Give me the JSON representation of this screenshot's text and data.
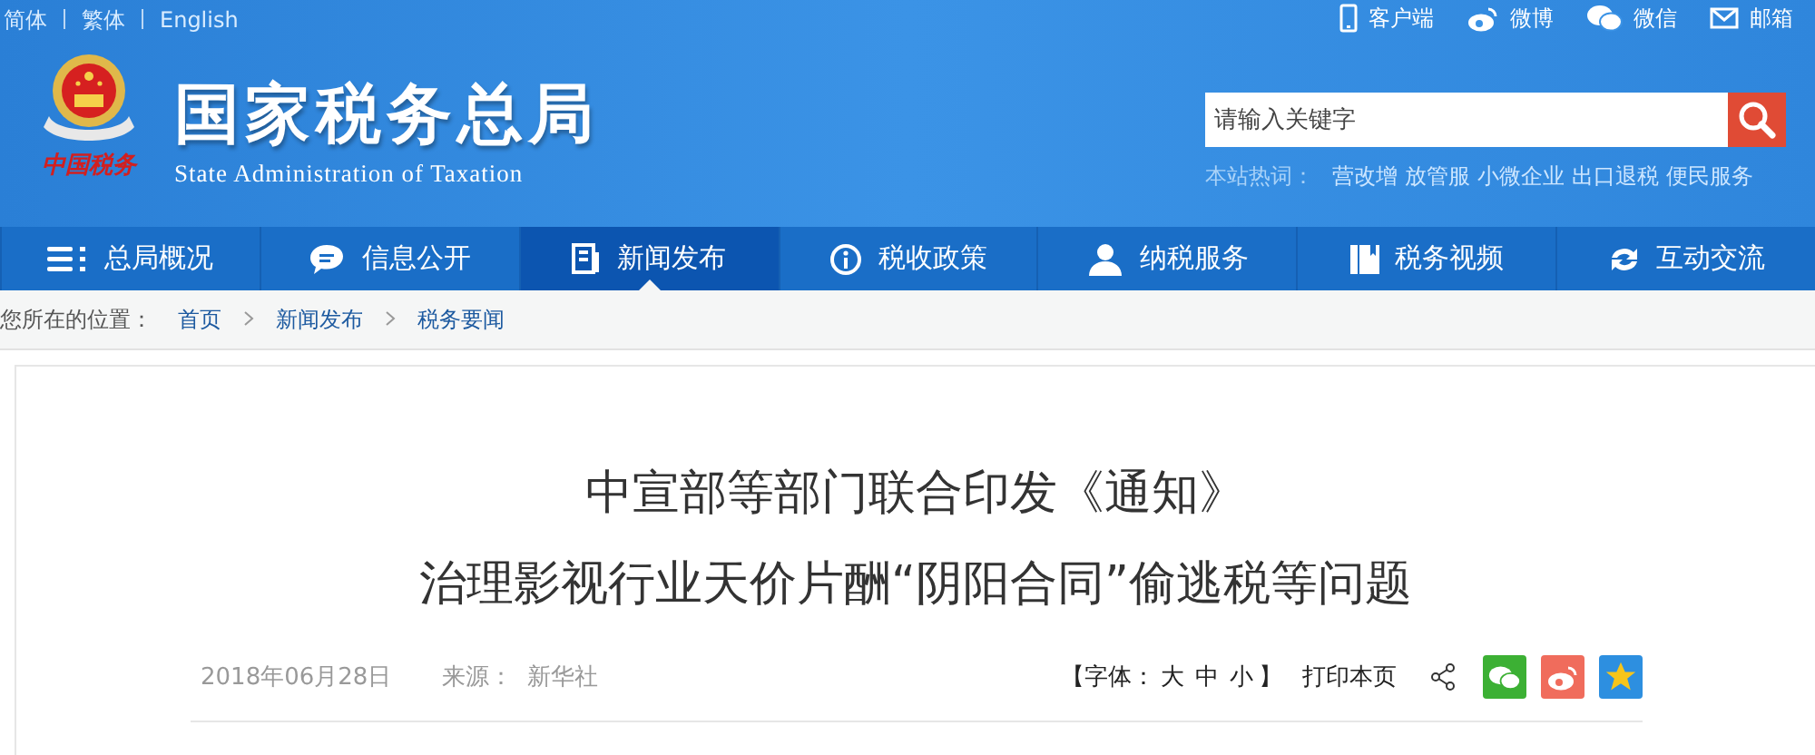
{
  "top_bar": {
    "languages": [
      "简体",
      "繁体",
      "English"
    ],
    "links": [
      {
        "label": "客户端"
      },
      {
        "label": "微博"
      },
      {
        "label": "微信"
      },
      {
        "label": "邮箱"
      }
    ]
  },
  "brand": {
    "seal_text": "中国税务",
    "title": "国家税务总局",
    "subtitle": "State Administration of Taxation"
  },
  "search": {
    "placeholder": "请输入关键字",
    "hot_label": "本站热词：",
    "hot_words": [
      "营改增",
      "放管服",
      "小微企业",
      "出口退税",
      "便民服务"
    ]
  },
  "nav": [
    {
      "label": "总局概况",
      "selected": false
    },
    {
      "label": "信息公开",
      "selected": false
    },
    {
      "label": "新闻发布",
      "selected": true
    },
    {
      "label": "税收政策",
      "selected": false
    },
    {
      "label": "纳税服务",
      "selected": false
    },
    {
      "label": "税务视频",
      "selected": false
    },
    {
      "label": "互动交流",
      "selected": false
    }
  ],
  "breadcrumb": {
    "label": "您所在的位置：",
    "items": [
      "首页",
      "新闻发布",
      "税务要闻"
    ]
  },
  "article": {
    "title_lines": [
      "中宣部等部门联合印发《通知》",
      "治理影视行业天价片酬“阴阳合同”偷逃税等问题"
    ],
    "date": "2018年06月28日",
    "source_label": "来源：",
    "source": "新华社",
    "font_open": "【字体：",
    "font_sizes": [
      "大",
      "中",
      "小"
    ],
    "font_close": "】",
    "print": "打印本页"
  }
}
